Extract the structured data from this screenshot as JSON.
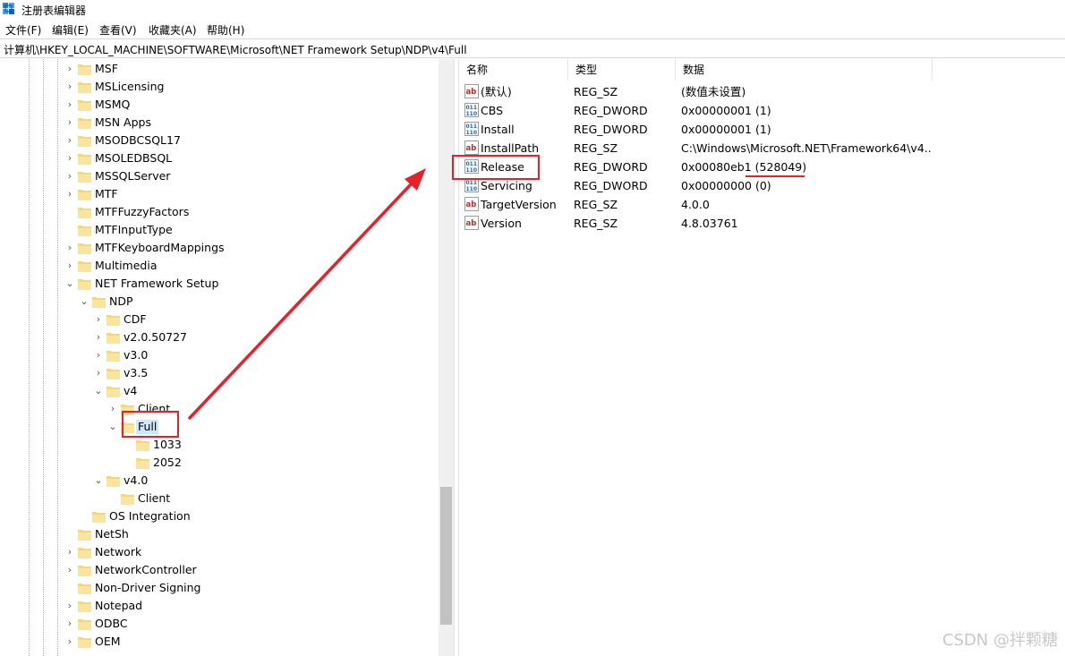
{
  "window": {
    "title": "注册表编辑器"
  },
  "menu": [
    {
      "label": "文件(F)"
    },
    {
      "label": "编辑(E)"
    },
    {
      "label": "查看(V)"
    },
    {
      "label": "收藏夹(A)"
    },
    {
      "label": "帮助(H)"
    }
  ],
  "address": {
    "path": "计算机\\HKEY_LOCAL_MACHINE\\SOFTWARE\\Microsoft\\NET Framework Setup\\NDP\\v4\\Full"
  },
  "tree": [
    {
      "label": "MSF",
      "expander": "collapsed",
      "depth": 0
    },
    {
      "label": "MSLicensing",
      "expander": "collapsed",
      "depth": 0
    },
    {
      "label": "MSMQ",
      "expander": "collapsed",
      "depth": 0
    },
    {
      "label": "MSN Apps",
      "expander": "collapsed",
      "depth": 0
    },
    {
      "label": "MSODBCSQL17",
      "expander": "collapsed",
      "depth": 0
    },
    {
      "label": "MSOLEDBSQL",
      "expander": "collapsed",
      "depth": 0
    },
    {
      "label": "MSSQLServer",
      "expander": "collapsed",
      "depth": 0
    },
    {
      "label": "MTF",
      "expander": "collapsed",
      "depth": 0
    },
    {
      "label": "MTFFuzzyFactors",
      "expander": "none",
      "depth": 0
    },
    {
      "label": "MTFInputType",
      "expander": "none",
      "depth": 0
    },
    {
      "label": "MTFKeyboardMappings",
      "expander": "collapsed",
      "depth": 0
    },
    {
      "label": "Multimedia",
      "expander": "collapsed",
      "depth": 0
    },
    {
      "label": "NET Framework Setup",
      "expander": "expanded",
      "depth": 0
    },
    {
      "label": "NDP",
      "expander": "expanded",
      "depth": 1
    },
    {
      "label": "CDF",
      "expander": "collapsed",
      "depth": 2
    },
    {
      "label": "v2.0.50727",
      "expander": "collapsed",
      "depth": 2
    },
    {
      "label": "v3.0",
      "expander": "collapsed",
      "depth": 2
    },
    {
      "label": "v3.5",
      "expander": "collapsed",
      "depth": 2
    },
    {
      "label": "v4",
      "expander": "expanded",
      "depth": 2
    },
    {
      "label": "Client",
      "expander": "collapsed",
      "depth": 3
    },
    {
      "label": "Full",
      "expander": "expanded",
      "depth": 3,
      "selected": true
    },
    {
      "label": "1033",
      "expander": "none",
      "depth": 4
    },
    {
      "label": "2052",
      "expander": "none",
      "depth": 4
    },
    {
      "label": "v4.0",
      "expander": "expanded",
      "depth": 2
    },
    {
      "label": "Client",
      "expander": "none",
      "depth": 3
    },
    {
      "label": "OS Integration",
      "expander": "none",
      "depth": 1
    },
    {
      "label": "NetSh",
      "expander": "none",
      "depth": 0
    },
    {
      "label": "Network",
      "expander": "collapsed",
      "depth": 0
    },
    {
      "label": "NetworkController",
      "expander": "collapsed",
      "depth": 0
    },
    {
      "label": "Non-Driver Signing",
      "expander": "none",
      "depth": 0
    },
    {
      "label": "Notepad",
      "expander": "collapsed",
      "depth": 0
    },
    {
      "label": "ODBC",
      "expander": "collapsed",
      "depth": 0
    },
    {
      "label": "OEM",
      "expander": "collapsed",
      "depth": 0
    }
  ],
  "columns": {
    "name": "名称",
    "type": "类型",
    "data": "数据"
  },
  "values": [
    {
      "name": "(默认)",
      "type": "REG_SZ",
      "data": "(数值未设置)",
      "icon": "string-value-icon"
    },
    {
      "name": "CBS",
      "type": "REG_DWORD",
      "data": "0x00000001 (1)",
      "icon": "dword-value-icon"
    },
    {
      "name": "Install",
      "type": "REG_DWORD",
      "data": "0x00000001 (1)",
      "icon": "dword-value-icon"
    },
    {
      "name": "InstallPath",
      "type": "REG_SZ",
      "data": "C:\\Windows\\Microsoft.NET\\Framework64\\v4....",
      "icon": "string-value-icon"
    },
    {
      "name": "Release",
      "type": "REG_DWORD",
      "data": "0x00080eb1 (528049)",
      "icon": "dword-value-icon"
    },
    {
      "name": "Servicing",
      "type": "REG_DWORD",
      "data": "0x00000000 (0)",
      "icon": "dword-value-icon"
    },
    {
      "name": "TargetVersion",
      "type": "REG_SZ",
      "data": "4.0.0",
      "icon": "string-value-icon"
    },
    {
      "name": "Version",
      "type": "REG_SZ",
      "data": "4.8.03761",
      "icon": "string-value-icon"
    }
  ],
  "colors": {
    "annotation": "#e8202a",
    "selection": "#cce8ff",
    "folder": "#f8d775"
  },
  "watermark": "CSDN @拌颗糖"
}
